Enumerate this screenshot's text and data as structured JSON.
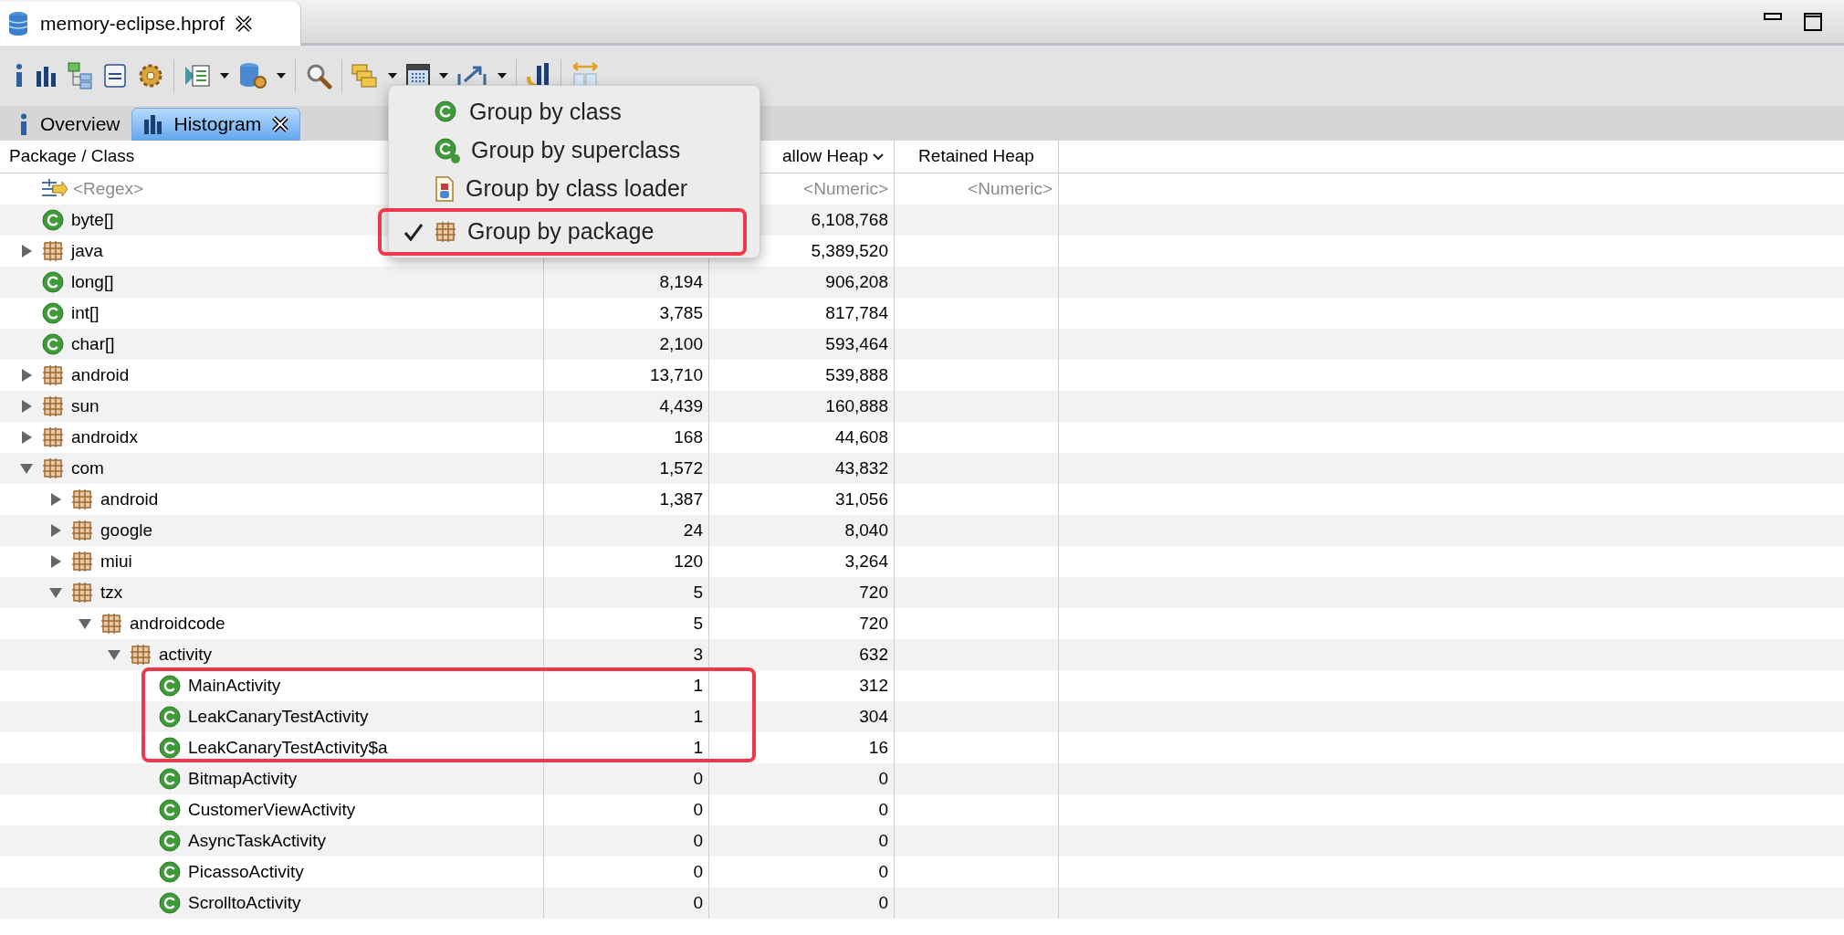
{
  "editor_tab": {
    "title": "memory-eclipse.hprof"
  },
  "view_tabs": [
    {
      "label": "Overview",
      "kind": "info",
      "selected": false,
      "closable": false
    },
    {
      "label": "Histogram",
      "kind": "histogram",
      "selected": true,
      "closable": true
    }
  ],
  "table": {
    "header": {
      "name": "Package / Class",
      "shallow_heap": "allow Heap",
      "shallow_sorted": true,
      "retained_heap": "Retained Heap"
    },
    "filter": {
      "name": "<Regex>",
      "shallow_heap": "<Numeric>",
      "retained_heap": "<Numeric>"
    },
    "rows": [
      {
        "name": "byte[]",
        "kind": "class",
        "shallow_heap": "6,108,768"
      },
      {
        "name": "java",
        "kind": "package",
        "expanded": false,
        "shallow_heap": "5,389,520"
      },
      {
        "name": "long[]",
        "kind": "class",
        "objects": "8,194",
        "shallow_heap": "906,208"
      },
      {
        "name": "int[]",
        "kind": "class",
        "objects": "3,785",
        "shallow_heap": "817,784"
      },
      {
        "name": "char[]",
        "kind": "class",
        "objects": "2,100",
        "shallow_heap": "593,464"
      },
      {
        "name": "android",
        "kind": "package",
        "expanded": false,
        "objects": "13,710",
        "shallow_heap": "539,888"
      },
      {
        "name": "sun",
        "kind": "package",
        "expanded": false,
        "objects": "4,439",
        "shallow_heap": "160,888"
      },
      {
        "name": "androidx",
        "kind": "package",
        "expanded": false,
        "objects": "168",
        "shallow_heap": "44,608"
      },
      {
        "name": "com",
        "kind": "package",
        "expanded": true,
        "objects": "1,572",
        "shallow_heap": "43,832",
        "children": [
          {
            "name": "android",
            "kind": "package",
            "expanded": false,
            "objects": "1,387",
            "shallow_heap": "31,056"
          },
          {
            "name": "google",
            "kind": "package",
            "expanded": false,
            "objects": "24",
            "shallow_heap": "8,040"
          },
          {
            "name": "miui",
            "kind": "package",
            "expanded": false,
            "objects": "120",
            "shallow_heap": "3,264"
          },
          {
            "name": "tzx",
            "kind": "package",
            "expanded": true,
            "objects": "5",
            "shallow_heap": "720",
            "children": [
              {
                "name": "androidcode",
                "kind": "package",
                "expanded": true,
                "objects": "5",
                "shallow_heap": "720",
                "children": [
                  {
                    "name": "activity",
                    "kind": "package",
                    "expanded": true,
                    "objects": "3",
                    "shallow_heap": "632",
                    "children": [
                      {
                        "name": "MainActivity",
                        "kind": "class",
                        "objects": "1",
                        "shallow_heap": "312"
                      },
                      {
                        "name": "LeakCanaryTestActivity",
                        "kind": "class",
                        "objects": "1",
                        "shallow_heap": "304"
                      },
                      {
                        "name": "LeakCanaryTestActivity$a",
                        "kind": "class",
                        "objects": "1",
                        "shallow_heap": "16"
                      },
                      {
                        "name": "BitmapActivity",
                        "kind": "class",
                        "objects": "0",
                        "shallow_heap": "0"
                      },
                      {
                        "name": "CustomerViewActivity",
                        "kind": "class",
                        "objects": "0",
                        "shallow_heap": "0"
                      },
                      {
                        "name": "AsyncTaskActivity",
                        "kind": "class",
                        "objects": "0",
                        "shallow_heap": "0"
                      },
                      {
                        "name": "PicassoActivity",
                        "kind": "class",
                        "objects": "0",
                        "shallow_heap": "0"
                      },
                      {
                        "name": "ScrolltoActivity",
                        "kind": "class",
                        "objects": "0",
                        "shallow_heap": "0"
                      }
                    ]
                  }
                ]
              }
            ]
          }
        ]
      }
    ]
  },
  "group_menu": {
    "items": [
      {
        "label": "Group by class",
        "kind": "class",
        "checked": false
      },
      {
        "label": "Group by superclass",
        "kind": "superclass",
        "checked": false
      },
      {
        "label": "Group by class loader",
        "kind": "loader",
        "checked": false
      },
      {
        "label": "Group by package",
        "kind": "package",
        "checked": true
      }
    ]
  }
}
